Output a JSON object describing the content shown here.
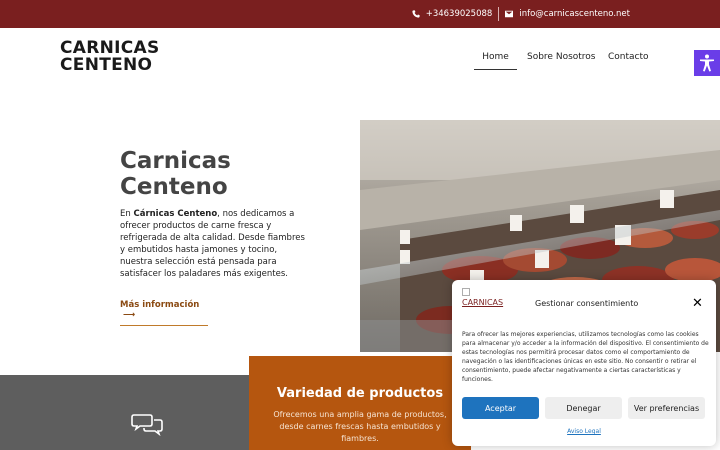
{
  "topbar": {
    "phone": "+34639025088",
    "email": "info@carnicascenteno.net"
  },
  "logo": {
    "line1": "CARNICAS",
    "line2": "CENTENO"
  },
  "nav": {
    "home": "Home",
    "about": "Sobre Nosotros",
    "contact": "Contacto"
  },
  "hero": {
    "title_line1": "Carnicas",
    "title_line2": "Centeno",
    "text_prefix": "En ",
    "text_bold": "Cárnicas Centeno",
    "text_rest": ", nos dedicamos a ofrecer productos de carne fresca y refrigerada de alta calidad. Desde fiambres y embutidos hasta jamones y tocino, nuestra selección está pensada para satisfacer los paladares más exigentes.",
    "more_label": "Más información"
  },
  "feature": {
    "title": "Variedad de productos",
    "description": "Ofrecemos una amplia gama de productos, desde carnes frescas hasta embutidos y fiambres."
  },
  "consent": {
    "logo_alt": "CARNICAS",
    "heading": "Gestionar consentimiento",
    "body": "Para ofrecer las mejores experiencias, utilizamos tecnologías como las cookies para almacenar y/o acceder a la información del dispositivo. El consentimiento de estas tecnologías nos permitirá procesar datos como el comportamiento de navegación o las identificaciones únicas en este sitio. No consentir o retirar el consentimiento, puede afectar negativamente a ciertas características y funciones.",
    "accept_label": "Aceptar",
    "deny_label": "Denegar",
    "prefs_label": "Ver preferencias",
    "legal_label": "Aviso Legal"
  },
  "colors": {
    "topbar": "#7a1f1f",
    "accent_orange": "#b5560f",
    "accept_blue": "#1e73be",
    "accessibility": "#6a3de8"
  }
}
